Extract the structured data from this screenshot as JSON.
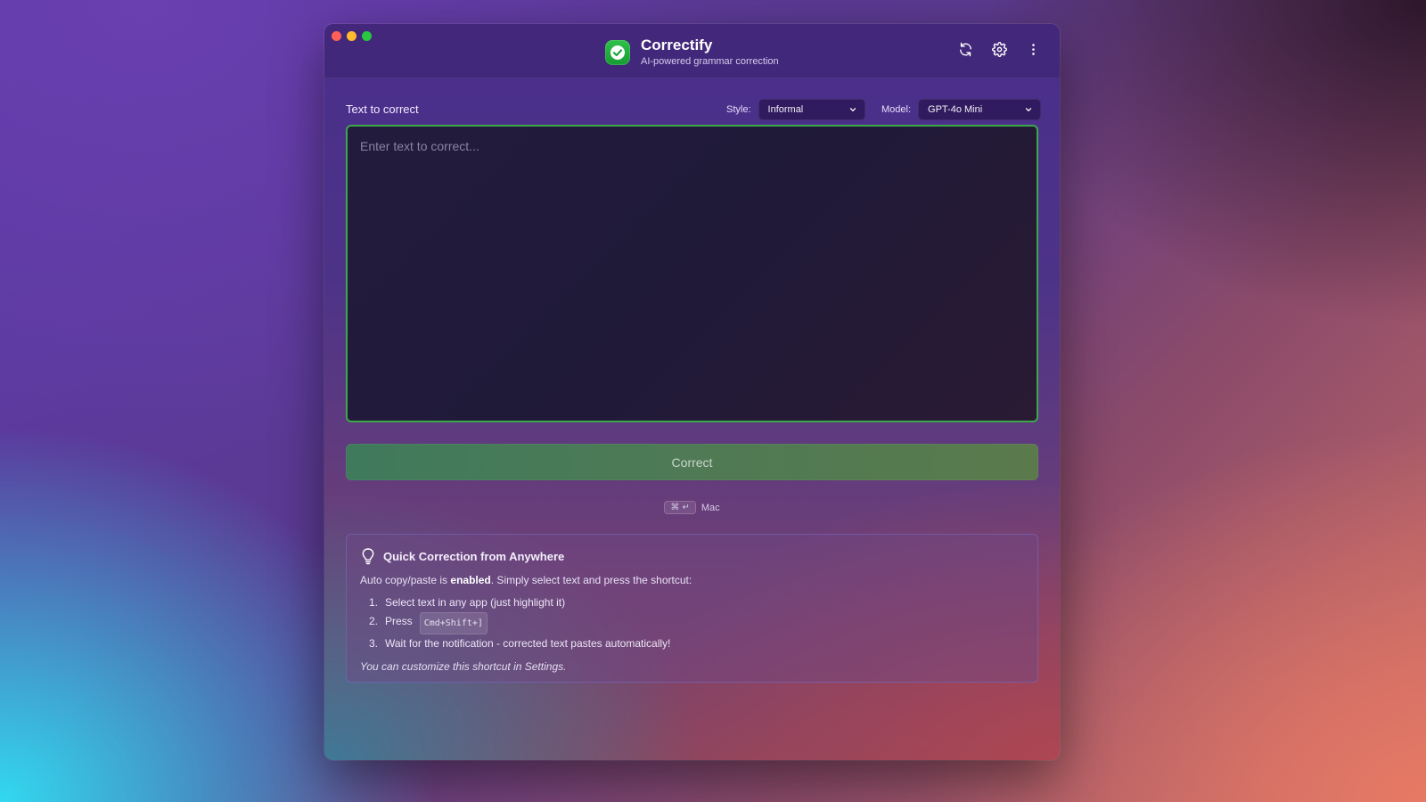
{
  "window": {
    "title": "Correctify",
    "subtitle": "AI-powered grammar correction",
    "accent_color": "#2fc14a"
  },
  "toolbar": {
    "icons": [
      "refresh-icon",
      "gear-icon",
      "more-vertical-icon"
    ]
  },
  "editor": {
    "section_label": "Text to correct",
    "style_label": "Style:",
    "style_value": "Informal",
    "model_label": "Model:",
    "model_value": "GPT-4o Mini",
    "placeholder": "Enter text to correct...",
    "value": ""
  },
  "action": {
    "correct_label": "Correct",
    "shortcut_keys": "⌘ ↵",
    "shortcut_platform": "Mac"
  },
  "info": {
    "title": "Quick Correction from Anywhere",
    "desc_prefix": "Auto copy/paste is",
    "desc_strong": "enabled",
    "desc_suffix": ". Simply select text and press the shortcut:",
    "steps": [
      {
        "num": "1.",
        "text": "Select text in any app (just highlight it)"
      },
      {
        "num": "2.",
        "text": "Press",
        "kbd": "Cmd+Shift+]"
      },
      {
        "num": "3.",
        "text": "Wait for the notification - corrected text pastes automatically!"
      }
    ],
    "note": "You can customize this shortcut in Settings."
  }
}
